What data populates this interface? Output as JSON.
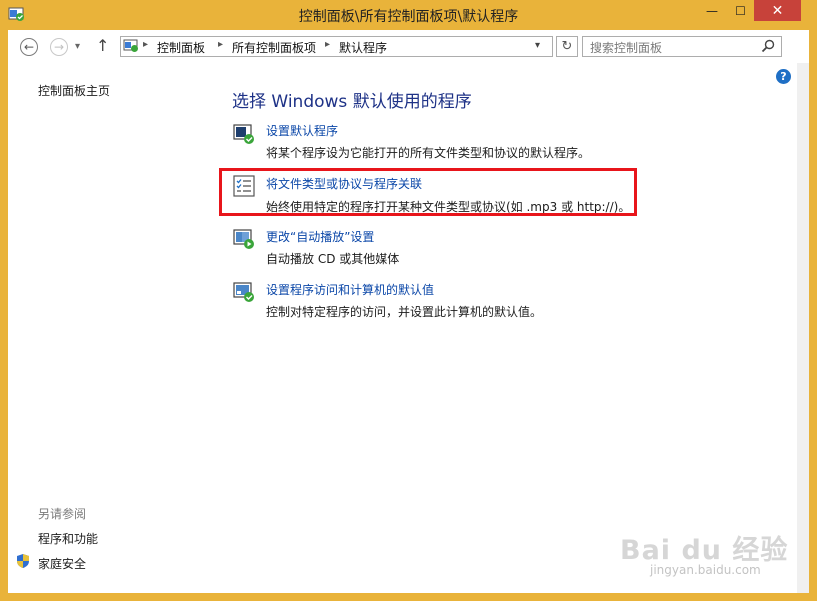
{
  "window": {
    "title": "控制面板\\所有控制面板项\\默认程序",
    "min_glyph": "—",
    "max_glyph": "☐",
    "close_glyph": "✕"
  },
  "nav": {
    "back_glyph": "←",
    "forward_glyph": "→",
    "dropdown_glyph": "▾",
    "up_glyph": "↑",
    "breadcrumb": [
      "控制面板",
      "所有控制面板项",
      "默认程序"
    ],
    "breadcrumb_sep": "▸",
    "refresh_glyph": "↻",
    "search_placeholder": "搜索控制面板"
  },
  "sidebar": {
    "home_link": "控制面板主页",
    "see_also_heading": "另请参阅",
    "see_also": [
      "程序和功能",
      "家庭安全"
    ]
  },
  "main": {
    "title": "选择 Windows 默认使用的程序",
    "items": [
      {
        "link": "设置默认程序",
        "desc": "将某个程序设为它能打开的所有文件类型和协议的默认程序。",
        "icon": "default-programs-icon"
      },
      {
        "link": "将文件类型或协议与程序关联",
        "desc": "始终使用特定的程序打开某种文件类型或协议(如 .mp3 或 http://)。",
        "icon": "file-association-icon"
      },
      {
        "link": "更改“自动播放”设置",
        "desc": "自动播放 CD 或其他媒体",
        "icon": "autoplay-icon"
      },
      {
        "link": "设置程序访问和计算机的默认值",
        "desc": "控制对特定程序的访问，并设置此计算机的默认值。",
        "icon": "program-access-icon"
      }
    ]
  },
  "watermark": {
    "brand": "Bai du 经验",
    "url": "jingyan.baidu.com"
  },
  "colors": {
    "frame": "#e9b33a",
    "link": "#0b47a8",
    "title": "#1e3287",
    "highlight": "#e8151b",
    "close": "#c7423a"
  }
}
